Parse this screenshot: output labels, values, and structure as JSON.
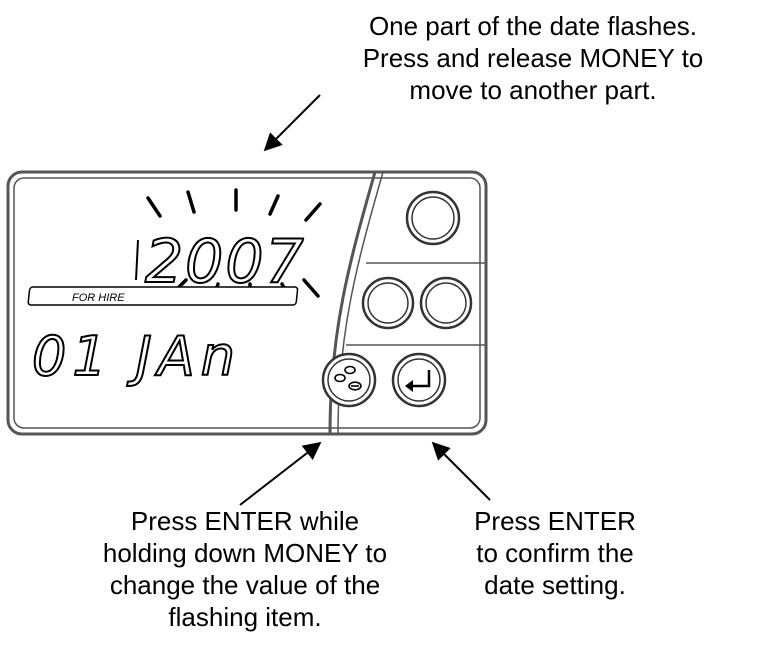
{
  "callouts": {
    "top": [
      "One part of the date flashes.",
      "Press and release MONEY to",
      "move to another part."
    ],
    "bottom_left": [
      "Press ENTER while",
      "holding down MONEY to",
      "change the value of the",
      "flashing item."
    ],
    "bottom_right": [
      "Press ENTER",
      "to confirm the",
      "date setting."
    ]
  },
  "display": {
    "year": "2007",
    "date": "01 JAn",
    "for_hire": "FOR HIRE"
  },
  "buttons": {
    "money_icon": "money-icon",
    "enter_icon": "enter-arrow-icon"
  },
  "colors": {
    "ink": "#000000",
    "panel_border": "#555555",
    "lcd_shadow": "#888888"
  }
}
